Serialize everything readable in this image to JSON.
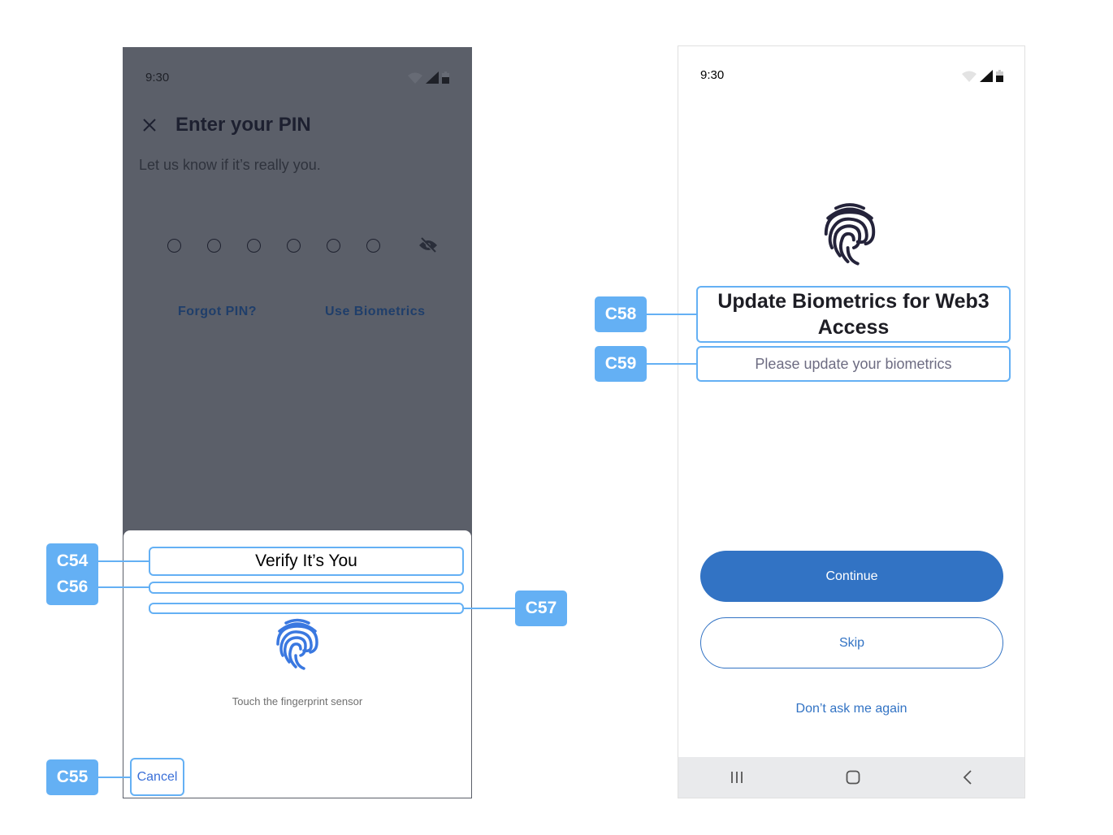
{
  "left_screen": {
    "status_time": "9:30",
    "title": "Enter your PIN",
    "subtitle": "Let us know if it’s really you.",
    "pin_length": 6,
    "forgot_pin": "Forgot PIN?",
    "use_biometrics": "Use Biometrics",
    "sheet": {
      "title": "Verify It’s You",
      "prompt": "Touch the fingerprint sensor",
      "cancel": "Cancel"
    }
  },
  "right_screen": {
    "status_time": "9:30",
    "title": "Update Biometrics for Web3 Access",
    "subtitle": "Please update your biometrics",
    "continue": "Continue",
    "skip": "Skip",
    "dont_ask": "Don’t ask me again"
  },
  "annotations": {
    "c54": "C54",
    "c55": "C55",
    "c56": "C56",
    "c57": "C57",
    "c58": "C58",
    "c59": "C59"
  },
  "colors": {
    "annotation": "#64b0f4",
    "primary": "#3273c4",
    "overlay": "#5b5f69"
  }
}
